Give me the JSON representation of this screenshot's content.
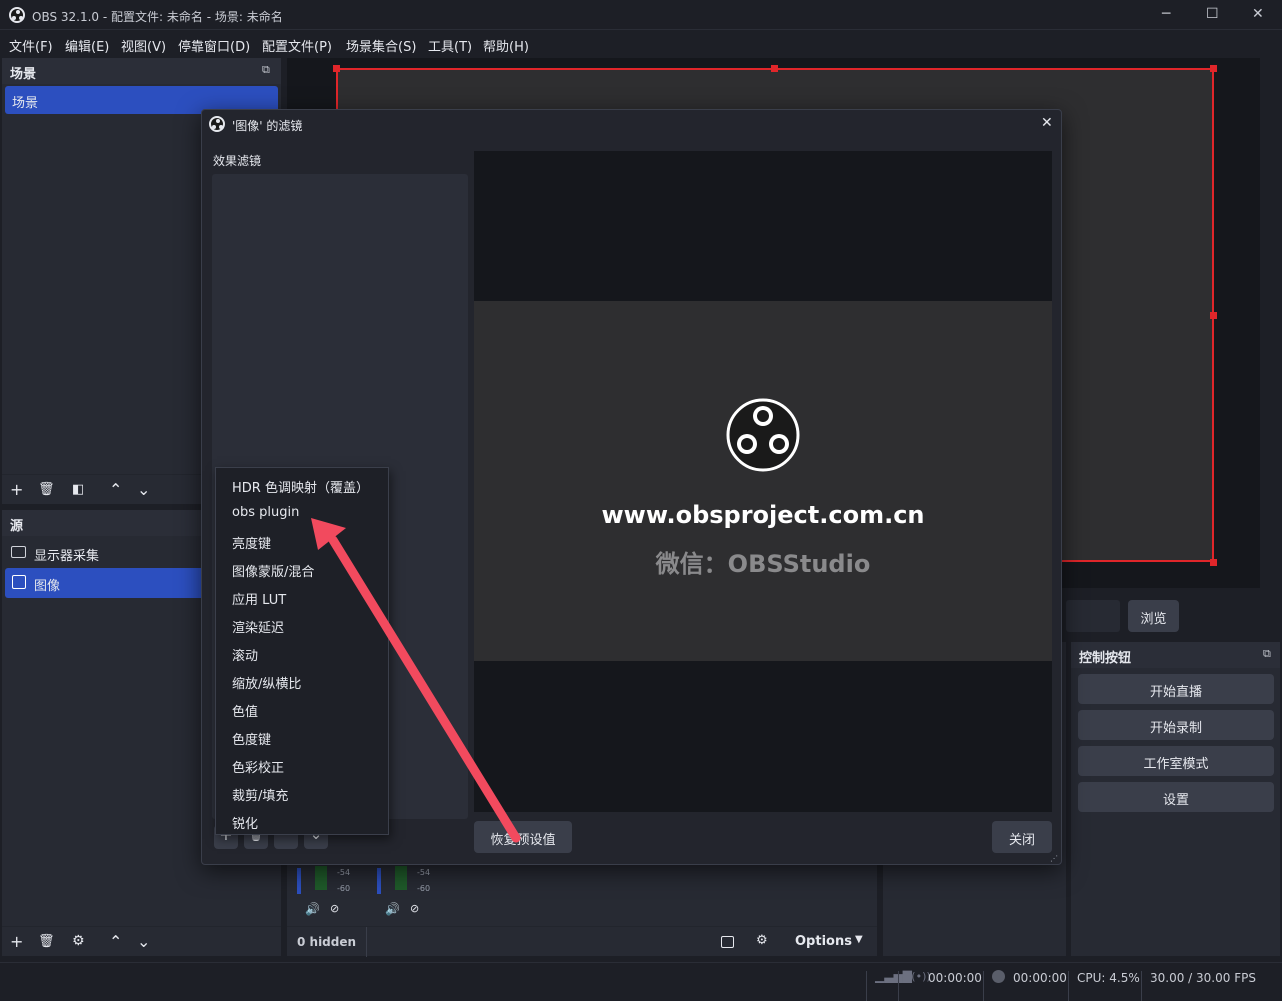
{
  "window": {
    "title": "OBS 32.1.0 - 配置文件: 未命名 - 场景: 未命名",
    "min": "─",
    "max": "☐",
    "close": "✕"
  },
  "menu": [
    "文件(F)",
    "编辑(E)",
    "视图(V)",
    "停靠窗口(D)",
    "配置文件(P)",
    "场景集合(S)",
    "工具(T)",
    "帮助(H)"
  ],
  "scenes": {
    "header": "场景",
    "items": [
      "场景"
    ],
    "float_icon": "⧉"
  },
  "sources": {
    "header": "源",
    "items": [
      {
        "label": "显示器采集",
        "icon": "monitor-icon"
      },
      {
        "label": "图像",
        "icon": "image-icon"
      }
    ]
  },
  "toolbar": {
    "add": "+",
    "remove": "🗑",
    "filter": "◧",
    "up": "⌃",
    "down": "⌄",
    "settings": "⚙"
  },
  "dialog": {
    "title": "'图像' 的滤镜",
    "close": "✕",
    "effect_filters": "效果滤镜",
    "website": "www.obsproject.com.cn",
    "wechat": "微信：OBSStudio",
    "restore": "恢复预设值",
    "close_btn": "关闭"
  },
  "filter_menu": [
    "HDR 色调映射（覆盖）",
    "obs plugin",
    "亮度键",
    "图像蒙版/混合",
    "应用 LUT",
    "渲染延迟",
    "滚动",
    "缩放/纵横比",
    "色值",
    "色度键",
    "色彩校正",
    "裁剪/填充",
    "锐化"
  ],
  "browse": "浏览",
  "controls": {
    "header": "控制按钮",
    "buttons": [
      "开始直播",
      "开始录制",
      "工作室模式",
      "设置"
    ]
  },
  "mixer": {
    "hidden": "0 hidden",
    "options": "Options",
    "db1": "-54",
    "db2": "-60"
  },
  "status": {
    "stream_time": "00:00:00",
    "rec_time": "00:00:00",
    "cpu": "CPU: 4.5%",
    "fps": "30.00 / 30.00 FPS"
  },
  "colors": {
    "accent": "#2c4fbf",
    "selection_red": "#e0262a",
    "arrow": "#f24a5e"
  }
}
